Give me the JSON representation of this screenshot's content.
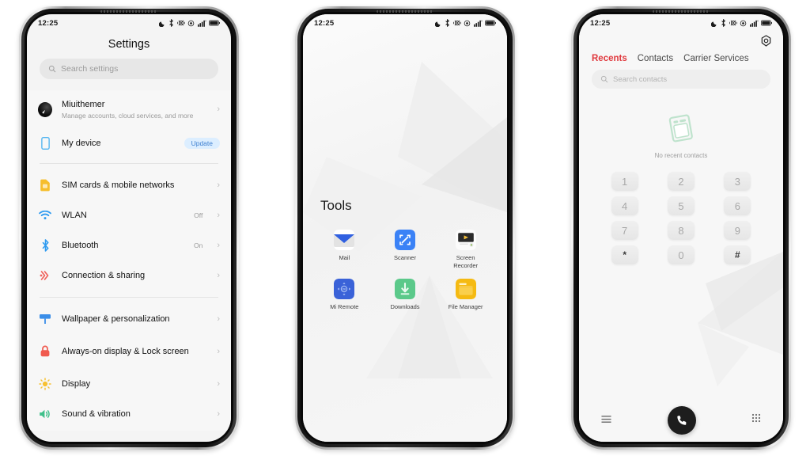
{
  "meta": {
    "background": "#ffffff",
    "accent_red": "#e0393e",
    "accent_blue": "#3d7fd0"
  },
  "status_bar": {
    "time": "12:25",
    "icons": [
      "dnd-moon-icon",
      "bluetooth-icon",
      "vibrate-icon",
      "data-saver-icon",
      "signal-bars-icon",
      "battery-icon"
    ]
  },
  "phone1": {
    "screen_name": "settings-screen",
    "title": "Settings",
    "search": {
      "placeholder": "Search settings",
      "icon": "search-icon"
    },
    "account": {
      "name": "Miuithemer",
      "subtitle": "Manage accounts, cloud services, and more",
      "avatar": "user-avatar",
      "chevron": "›"
    },
    "device": {
      "label": "My device",
      "badge": "Update",
      "icon": "phone-outline-icon"
    },
    "groups": [
      {
        "items": [
          {
            "label": "SIM cards & mobile networks",
            "value": "",
            "icon": "sim-card-icon",
            "color": "#f6be2c",
            "chevron": "›"
          },
          {
            "label": "WLAN",
            "value": "Off",
            "icon": "wifi-icon",
            "color": "#2f9bf0",
            "chevron": "›"
          },
          {
            "label": "Bluetooth",
            "value": "On",
            "icon": "bluetooth-icon",
            "color": "#2f9bf0",
            "chevron": "›"
          },
          {
            "label": "Connection & sharing",
            "value": "",
            "icon": "connection-sharing-icon",
            "color": "#f0625c",
            "chevron": "›"
          }
        ]
      },
      {
        "items": [
          {
            "label": "Wallpaper & personalization",
            "value": "",
            "icon": "wallpaper-icon",
            "color": "#3b8ee8",
            "chevron": "›"
          },
          {
            "label": "Always-on display & Lock screen",
            "value": "",
            "icon": "lock-icon",
            "color": "#f05a4f",
            "chevron": "›"
          },
          {
            "label": "Display",
            "value": "",
            "icon": "brightness-sun-icon",
            "color": "#f7c132",
            "chevron": "›"
          },
          {
            "label": "Sound & vibration",
            "value": "",
            "icon": "speaker-icon",
            "color": "#3fc08a",
            "chevron": "›"
          }
        ]
      }
    ]
  },
  "phone2": {
    "screen_name": "tools-folder-screen",
    "folder_title": "Tools",
    "apps": [
      {
        "name": "Mail",
        "icon": "mail-icon"
      },
      {
        "name": "Scanner",
        "icon": "scanner-icon"
      },
      {
        "name": "Screen Recorder",
        "icon": "screen-recorder-icon"
      },
      {
        "name": "Mi Remote",
        "icon": "mi-remote-icon"
      },
      {
        "name": "Downloads",
        "icon": "downloads-icon"
      },
      {
        "name": "File Manager",
        "icon": "file-manager-icon"
      }
    ]
  },
  "phone3": {
    "screen_name": "dialer-screen",
    "settings_icon": "gear-icon",
    "tabs": [
      {
        "label": "Recents",
        "active": true
      },
      {
        "label": "Contacts",
        "active": false
      },
      {
        "label": "Carrier Services",
        "active": false
      }
    ],
    "search": {
      "placeholder": "Search contacts",
      "icon": "search-icon"
    },
    "empty_state": {
      "text": "No recent contacts",
      "icon": "empty-contacts-icon"
    },
    "keypad": [
      "1",
      "2",
      "3",
      "4",
      "5",
      "6",
      "7",
      "8",
      "9",
      "*",
      "0",
      "#"
    ],
    "bottom_bar": {
      "left_icon": "menu-list-icon",
      "call_icon": "call-handset-icon",
      "right_icon": "keypad-grid-icon"
    }
  }
}
